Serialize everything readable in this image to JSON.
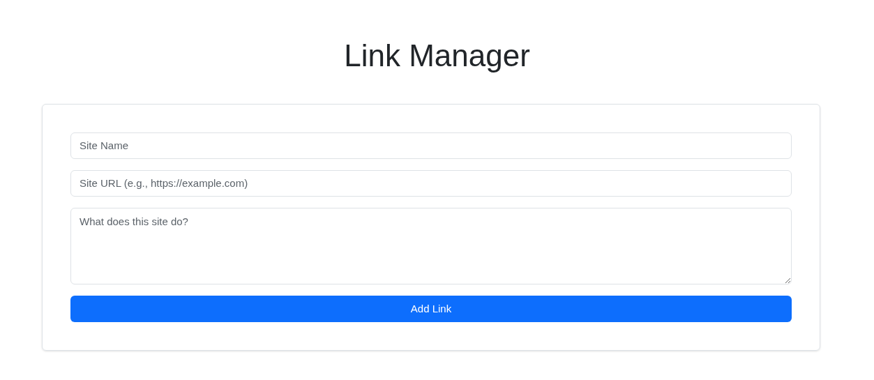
{
  "title": "Link Manager",
  "form": {
    "fields": [
      {
        "kind": "input",
        "placeholder": "Site Name"
      },
      {
        "kind": "input",
        "placeholder": "Site URL (e.g., https://example.com)"
      },
      {
        "kind": "textarea",
        "placeholder": "What does this site do?"
      }
    ],
    "submit": "Add Link"
  }
}
